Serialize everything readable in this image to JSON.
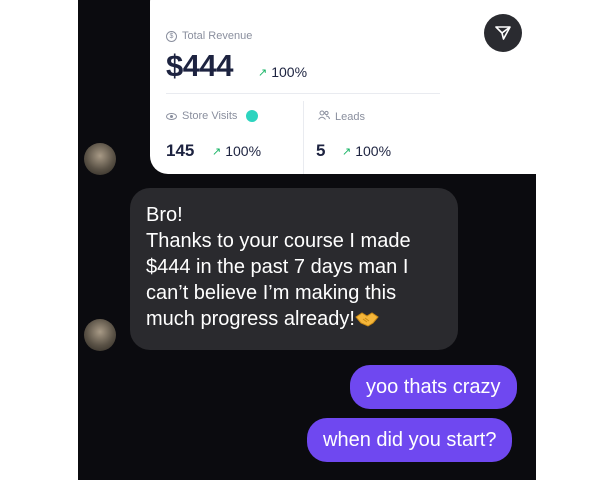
{
  "stats_card": {
    "total_revenue_label": "Total Revenue",
    "total_revenue_value": "$444",
    "total_revenue_change": "100%",
    "store_visits_label": "Store Visits",
    "store_visits_value": "145",
    "store_visits_change": "100%",
    "leads_label": "Leads",
    "leads_value": "5",
    "leads_change": "100%",
    "trend_color": "#16b364",
    "live_dot_color": "#2dd4bf"
  },
  "messages": {
    "incoming": [
      "Bro!",
      "Thanks to your course I made",
      "$444 in the past 7 days man I",
      "can’t believe I’m making this",
      "much progress already!"
    ],
    "outgoing": [
      "yoo thats crazy",
      "when did you start?"
    ]
  },
  "icons": {
    "share": "share-icon",
    "emoji": "handshake-icon"
  },
  "colors": {
    "chat_background": "#0b0b0f",
    "incoming_bubble": "#2a2a2e",
    "outgoing_bubble": "#6f48f0"
  }
}
